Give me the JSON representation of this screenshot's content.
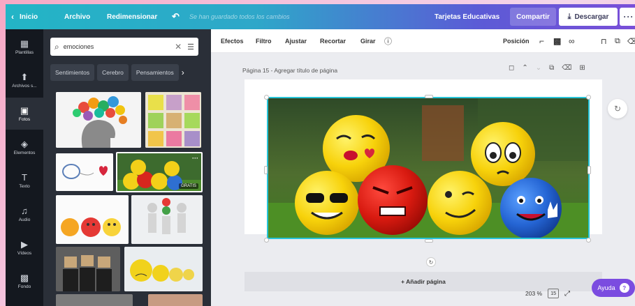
{
  "topbar": {
    "home": "Inicio",
    "file": "Archivo",
    "resize": "Redimensionar",
    "undo_icon": "undo-icon",
    "save_status": "Se han guardado todos los cambios",
    "doc_title": "Tarjetas Educativas",
    "share": "Compartir",
    "download": "Descargar",
    "more": "···"
  },
  "leftnav": {
    "items": [
      {
        "label": "Plantillas",
        "icon": "▦"
      },
      {
        "label": "Archivos s...",
        "icon": "⬆"
      },
      {
        "label": "Fotos",
        "icon": "▣"
      },
      {
        "label": "Elementos",
        "icon": "◈"
      },
      {
        "label": "Texto",
        "icon": "T"
      },
      {
        "label": "Audio",
        "icon": "♫"
      },
      {
        "label": "Vídeos",
        "icon": "▶"
      },
      {
        "label": "Fondo",
        "icon": "▩"
      }
    ]
  },
  "panel": {
    "search_value": "emociones",
    "chips": [
      "Sentimientos",
      "Cerebro",
      "Pensamientos"
    ],
    "free_badge": "GRATIS",
    "thumb_more": "···"
  },
  "toolbar": {
    "effects": "Efectos",
    "filter": "Filtro",
    "adjust": "Ajustar",
    "crop": "Recortar",
    "flip": "Girar",
    "position": "Posición"
  },
  "canvas": {
    "page_title": "Página 15 - Agregar título de página",
    "add_page": "+ Añadir página",
    "zoom": "203 %",
    "page_count": "15"
  },
  "help": {
    "label": "Ayuda",
    "icon": "?"
  },
  "colors": {
    "accent_teal": "#27c4d8",
    "help_purple": "#7b4ce0",
    "panel_dark": "#2a2f38"
  }
}
